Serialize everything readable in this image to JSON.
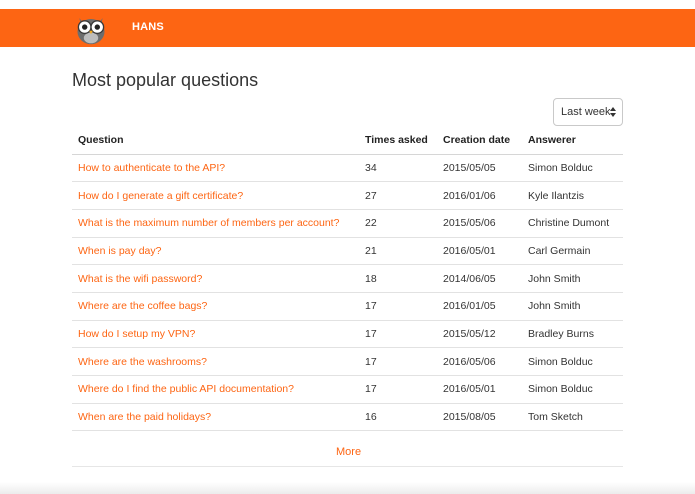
{
  "navbar": {
    "brand": "HANS",
    "color": "#fd6513",
    "logo_icon": "owl-icon"
  },
  "page": {
    "title": "Most popular questions"
  },
  "filter": {
    "selected": "Last week",
    "icon": "updown-chevron-icon"
  },
  "table": {
    "headers": {
      "question": "Question",
      "times_asked": "Times asked",
      "creation_date": "Creation date",
      "answerer": "Answerer"
    },
    "rows": [
      {
        "question": "How to authenticate to the API?",
        "times_asked": "34",
        "creation_date": "2015/05/05",
        "answerer": "Simon Bolduc"
      },
      {
        "question": "How do I generate a gift certificate?",
        "times_asked": "27",
        "creation_date": "2016/01/06",
        "answerer": "Kyle Ilantzis"
      },
      {
        "question": "What is the maximum number of members per account?",
        "times_asked": "22",
        "creation_date": "2015/05/06",
        "answerer": "Christine Dumont"
      },
      {
        "question": "When is pay day?",
        "times_asked": "21",
        "creation_date": "2016/05/01",
        "answerer": "Carl Germain"
      },
      {
        "question": "What is the wifi password?",
        "times_asked": "18",
        "creation_date": "2014/06/05",
        "answerer": "John Smith"
      },
      {
        "question": "Where are the coffee bags?",
        "times_asked": "17",
        "creation_date": "2016/01/05",
        "answerer": "John Smith"
      },
      {
        "question": "How do I setup my VPN?",
        "times_asked": "17",
        "creation_date": "2015/05/12",
        "answerer": "Bradley Burns"
      },
      {
        "question": "Where are the washrooms?",
        "times_asked": "17",
        "creation_date": "2016/05/06",
        "answerer": "Simon Bolduc"
      },
      {
        "question": "Where do I find the public API documentation?",
        "times_asked": "17",
        "creation_date": "2016/05/01",
        "answerer": "Simon Bolduc"
      },
      {
        "question": "When are the paid holidays?",
        "times_asked": "16",
        "creation_date": "2015/08/05",
        "answerer": "Tom Sketch"
      }
    ]
  },
  "more": {
    "label": "More"
  }
}
